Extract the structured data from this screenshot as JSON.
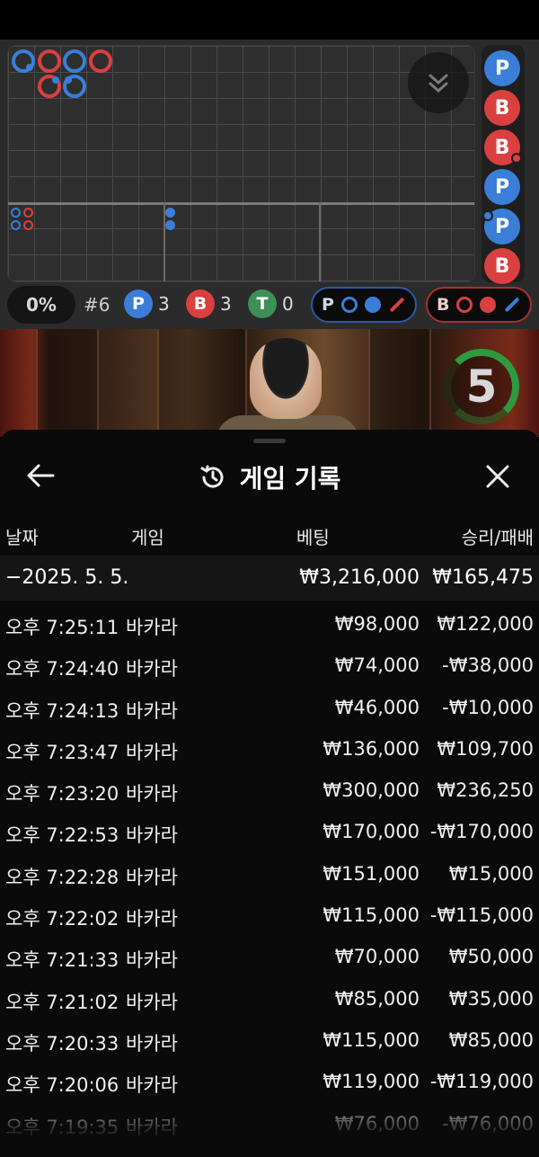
{
  "colors": {
    "player": "#3a7ed8",
    "banker": "#d9403f",
    "tie": "#3e8f58",
    "accent_green": "#2e9a3e"
  },
  "status": {
    "percent": "0%",
    "shoe": "#6",
    "player_label": "P",
    "player_count": "3",
    "banker_label": "B",
    "banker_count": "3",
    "tie_label": "T",
    "tie_count": "0",
    "player_predict_label": "P",
    "banker_predict_label": "B"
  },
  "side_beads": [
    "P",
    "B",
    "B",
    "P",
    "P",
    "B"
  ],
  "timer": "5",
  "history": {
    "title": "게임 기록",
    "columns": {
      "date": "날짜",
      "game": "게임",
      "bet": "베팅",
      "winloss": "승리/패배"
    },
    "summary": {
      "date": "−2025. 5. 5.",
      "bet": "₩3,216,000",
      "winloss": "₩165,475"
    },
    "rows": [
      {
        "time": "오후 7:25:11",
        "game": "바카라",
        "bet": "₩98,000",
        "winloss": "₩122,000"
      },
      {
        "time": "오후 7:24:40",
        "game": "바카라",
        "bet": "₩74,000",
        "winloss": "-₩38,000"
      },
      {
        "time": "오후 7:24:13",
        "game": "바카라",
        "bet": "₩46,000",
        "winloss": "-₩10,000"
      },
      {
        "time": "오후 7:23:47",
        "game": "바카라",
        "bet": "₩136,000",
        "winloss": "₩109,700"
      },
      {
        "time": "오후 7:23:20",
        "game": "바카라",
        "bet": "₩300,000",
        "winloss": "₩236,250"
      },
      {
        "time": "오후 7:22:53",
        "game": "바카라",
        "bet": "₩170,000",
        "winloss": "-₩170,000"
      },
      {
        "time": "오후 7:22:28",
        "game": "바카라",
        "bet": "₩151,000",
        "winloss": "₩15,000"
      },
      {
        "time": "오후 7:22:02",
        "game": "바카라",
        "bet": "₩115,000",
        "winloss": "-₩115,000"
      },
      {
        "time": "오후 7:21:33",
        "game": "바카라",
        "bet": "₩70,000",
        "winloss": "₩50,000"
      },
      {
        "time": "오후 7:21:02",
        "game": "바카라",
        "bet": "₩85,000",
        "winloss": "₩35,000"
      },
      {
        "time": "오후 7:20:33",
        "game": "바카라",
        "bet": "₩115,000",
        "winloss": "₩85,000"
      },
      {
        "time": "오후 7:20:06",
        "game": "바카라",
        "bet": "₩119,000",
        "winloss": "-₩119,000"
      },
      {
        "time": "오후 7:19:35",
        "game": "바카라",
        "bet": "₩76,000",
        "winloss": "-₩76,000"
      }
    ]
  }
}
